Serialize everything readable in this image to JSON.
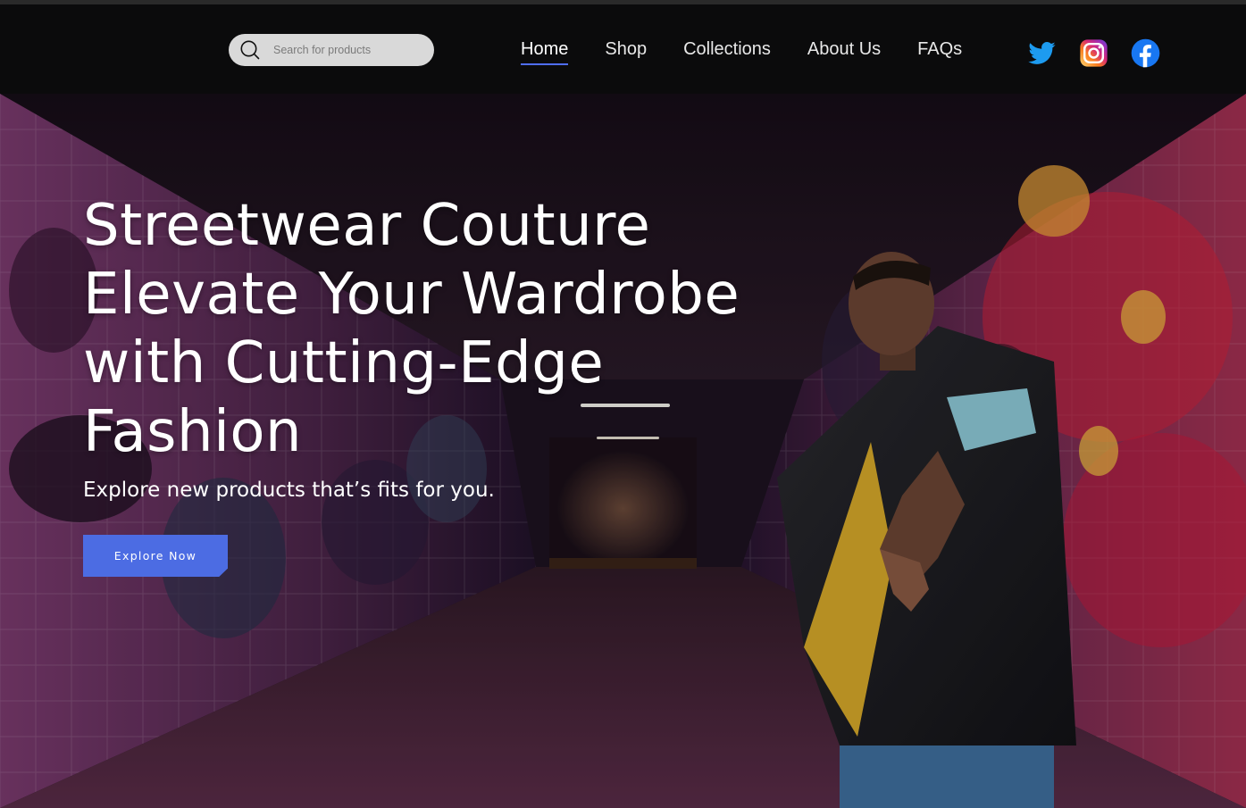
{
  "header": {
    "search": {
      "placeholder": "Search for products",
      "icon": "search-icon"
    },
    "nav": [
      {
        "label": "Home",
        "active": true
      },
      {
        "label": "Shop",
        "active": false
      },
      {
        "label": "Collections",
        "active": false
      },
      {
        "label": "About Us",
        "active": false
      },
      {
        "label": "FAQs",
        "active": false
      }
    ],
    "social": [
      {
        "icon": "twitter-icon",
        "color": "#1d9bf0"
      },
      {
        "icon": "instagram-icon",
        "color": "#e1306c"
      },
      {
        "icon": "facebook-icon",
        "color": "#1877f2"
      }
    ]
  },
  "hero": {
    "headline": "Streetwear Couture Elevate Your Wardrobe with Cutting-Edge Fashion",
    "subtext": "Explore new products that’s fits for you.",
    "cta_label": "Explore Now",
    "accent_color": "#4c6ce3"
  }
}
